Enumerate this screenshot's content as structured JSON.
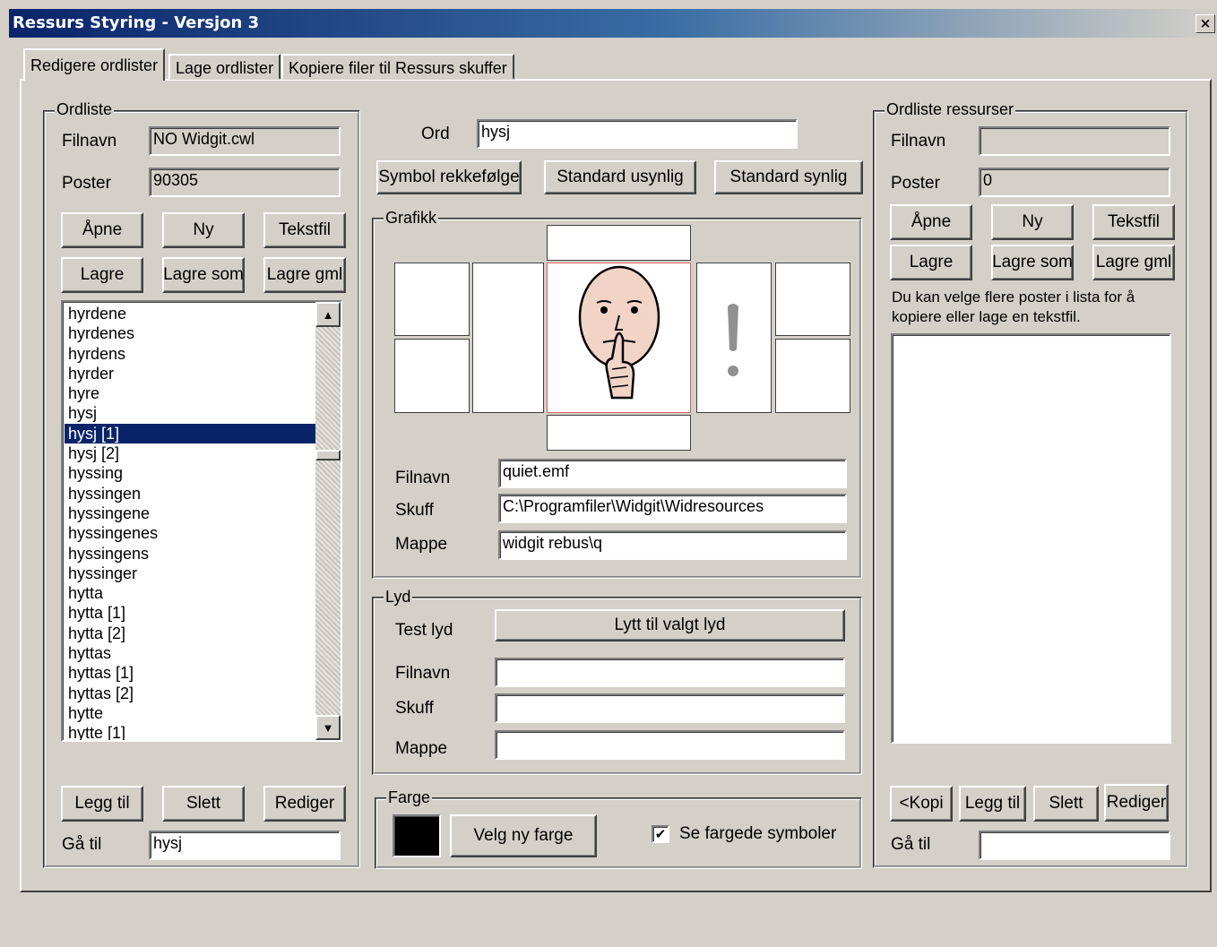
{
  "window": {
    "title": "Ressurs Styring - Versjon 3",
    "close_glyph": "×"
  },
  "tabs": [
    {
      "label": "Redigere ordlister",
      "active": true
    },
    {
      "label": "Lage ordlister",
      "active": false
    },
    {
      "label": "Kopiere filer til Ressurs skuffer",
      "active": false
    }
  ],
  "ordliste": {
    "legend": "Ordliste",
    "filnavn_label": "Filnavn",
    "filnavn_value": "NO Widgit.cwl",
    "poster_label": "Poster",
    "poster_value": "90305",
    "buttons": {
      "open": "Åpne",
      "new": "Ny",
      "textfile": "Tekstfil",
      "save": "Lagre",
      "save_as": "Lagre som",
      "save_old": "Lagre gml"
    },
    "list_items": [
      "hyrdene",
      "hyrdenes",
      "hyrdens",
      "hyrder",
      "hyre",
      "hysj",
      "hysj [1]",
      "hysj [2]",
      "hyssing",
      "hyssingen",
      "hyssingene",
      "hyssingenes",
      "hyssingens",
      "hyssinger",
      "hytta",
      "hytta [1]",
      "hytta [2]",
      "hyttas",
      "hyttas [1]",
      "hyttas [2]",
      "hytte",
      "hytte [1]"
    ],
    "selected_item": "hysj [1]",
    "scroll_up_glyph": "▲",
    "scroll_down_glyph": "▼",
    "add_button": "Legg til",
    "delete_button": "Slett",
    "edit_button": "Rediger",
    "goto_label": "Gå til",
    "goto_value": "hysj"
  },
  "center": {
    "ord_label": "Ord",
    "ord_value": "hysj",
    "symbol_order_button": "Symbol rekkefølge",
    "default_invisible_button": "Standard usynlig",
    "default_visible_button": "Standard synlig",
    "grafikk": {
      "legend": "Grafikk",
      "symbol_icon": "quiet-face-icon",
      "exclamation_icon": "exclamation-icon",
      "filnavn_label": "Filnavn",
      "filnavn_value": "quiet.emf",
      "skuff_label": "Skuff",
      "skuff_value": "C:\\Programfiler\\Widgit\\Widresources",
      "mappe_label": "Mappe",
      "mappe_value": "widgit rebus\\q"
    },
    "lyd": {
      "legend": "Lyd",
      "test_label": "Test lyd",
      "listen_button": "Lytt til valgt lyd",
      "filnavn_label": "Filnavn",
      "filnavn_value": "",
      "skuff_label": "Skuff",
      "skuff_value": "",
      "mappe_label": "Mappe",
      "mappe_value": ""
    },
    "farge": {
      "legend": "Farge",
      "swatch_color": "#000000",
      "choose_color_button": "Velg ny farge",
      "show_colored_label": "Se fargede symboler",
      "show_colored_checked": true,
      "check_glyph": "✔"
    }
  },
  "ressurser": {
    "legend": "Ordliste ressurser",
    "filnavn_label": "Filnavn",
    "filnavn_value": "",
    "poster_label": "Poster",
    "poster_value": "0",
    "buttons": {
      "open": "Åpne",
      "new": "Ny",
      "textfile": "Tekstfil",
      "save": "Lagre",
      "save_as": "Lagre som",
      "save_old": "Lagre gml"
    },
    "hint": "Du kan velge flere poster i lista for å kopiere eller lage en tekstfil.",
    "copy_button": "<Kopi",
    "add_button": "Legg til",
    "delete_button": "Slett",
    "edit_button": "Rediger",
    "goto_label": "Gå til",
    "goto_value": ""
  },
  "colors": {
    "face": "#d4d0c8",
    "selection": "#0a246a",
    "title_start": "#0a246a",
    "symbol_border": "#e06060",
    "skin": "#f2d4c6"
  }
}
